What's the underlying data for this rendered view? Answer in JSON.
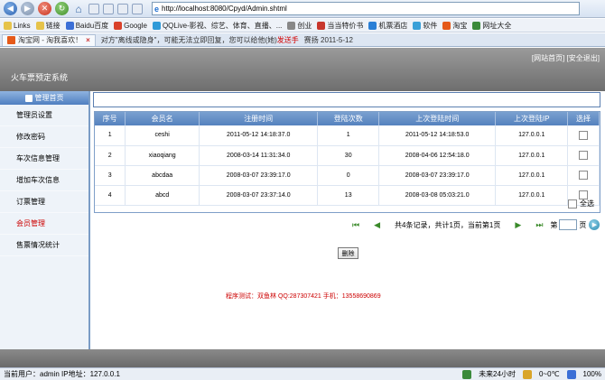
{
  "browser": {
    "url": "http://localhost:8080/Cpyd/Admin.shtml",
    "favorites": [
      {
        "label": "Links",
        "color": "#e6c34a"
      },
      {
        "label": "链接",
        "color": "#e6c34a"
      },
      {
        "label": "Baidu百度",
        "color": "#3b6fd6"
      },
      {
        "label": "Google",
        "color": "#d9412a"
      },
      {
        "label": "QQLive-影视、综艺、体育、直播、...",
        "color": "#2f9ad8"
      },
      {
        "label": "创业",
        "color": "#888888"
      },
      {
        "label": "当当特价书",
        "color": "#c8372d"
      },
      {
        "label": "机票酒店",
        "color": "#2a7fd6"
      },
      {
        "label": "软件",
        "color": "#3aa0d8"
      },
      {
        "label": "淘宝",
        "color": "#e55a1a"
      },
      {
        "label": "网址大全",
        "color": "#3b8a3b"
      }
    ],
    "tab_label": "淘宝网 - 淘我喜欢！",
    "ticker": "对方\"离线或隐身\"，可能无法立即回复，您可以给他(她)",
    "ticker_highlight": "发送手",
    "ticker2": "赛扬",
    "ticker3": "2011-5-12"
  },
  "header": {
    "title": "火车票预定系统",
    "link_home": "[网站首页]",
    "link_logout": "[安全退出]"
  },
  "sidebar": {
    "head": "管理首页",
    "items": [
      {
        "label": "管理员设置",
        "active": false
      },
      {
        "label": "修改密码",
        "active": false
      },
      {
        "label": "车次信息管理",
        "active": false
      },
      {
        "label": "增加车次信息",
        "active": false
      },
      {
        "label": "订票管理",
        "active": false
      },
      {
        "label": "会员管理",
        "active": true
      },
      {
        "label": "售票情况统计",
        "active": false
      }
    ]
  },
  "table": {
    "headers": [
      "序号",
      "会员名",
      "注册时间",
      "登陆次数",
      "上次登陆时间",
      "上次登陆IP",
      "选择"
    ],
    "rows": [
      [
        "1",
        "ceshi",
        "2011-05-12 14:18:37.0",
        "1",
        "2011-05-12 14:18:53.0",
        "127.0.0.1"
      ],
      [
        "2",
        "xiaoqiang",
        "2008-03-14 11:31:34.0",
        "30",
        "2008-04-06 12:54:18.0",
        "127.0.0.1"
      ],
      [
        "3",
        "abcdaa",
        "2008-03-07 23:39:17.0",
        "0",
        "2008-03-07 23:39:17.0",
        "127.0.0.1"
      ],
      [
        "4",
        "abcd",
        "2008-03-07 23:37:14.0",
        "13",
        "2008-03-08 05:03:21.0",
        "127.0.0.1"
      ]
    ],
    "select_all": "全选"
  },
  "pager": {
    "info": "共4条记录，共计1页，当前第1页",
    "page_prefix": "第",
    "page_suffix": "页"
  },
  "actions": {
    "delete": "删除"
  },
  "credit": "程序测试：双鱼林  QQ:287307421  手机：13558690869",
  "status": {
    "user": "当前用户：admin  IP地址：127.0.0.1",
    "weather": "未来24小时",
    "temp": "0~0℃",
    "zoom": "100%"
  }
}
